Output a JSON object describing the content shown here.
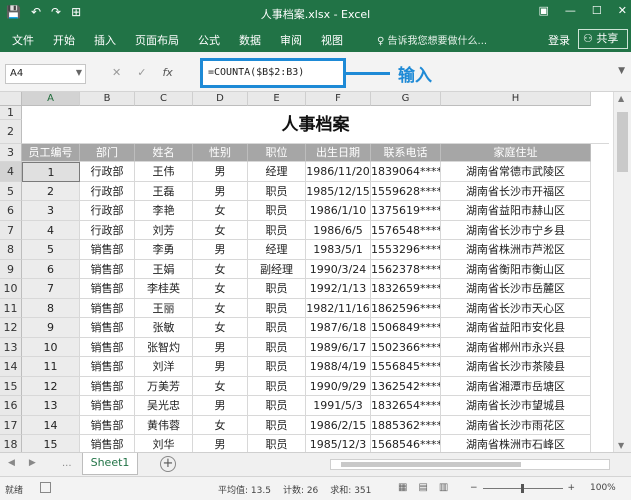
{
  "window": {
    "title": "人事档案.xlsx - Excel",
    "quick_access": [
      "💾",
      "↶",
      "↷",
      "⊞"
    ],
    "controls": [
      "▣",
      "—",
      "☐",
      "✕"
    ]
  },
  "ribbon": {
    "tabs": [
      "文件",
      "开始",
      "插入",
      "页面布局",
      "公式",
      "数据",
      "审阅",
      "视图"
    ],
    "tell_me": "告诉我您想要做什么...",
    "login": "登录",
    "share": "共享"
  },
  "formula_bar": {
    "name_box": "A4",
    "cancel": "✕",
    "enter": "✓",
    "fx": "fx",
    "formula": "=COUNTA($B$2:B3)",
    "callout": "输入"
  },
  "sheet": {
    "columns": [
      "A",
      "B",
      "C",
      "D",
      "E",
      "F",
      "G",
      "H"
    ],
    "title": "人事档案",
    "headers": [
      "员工编号",
      "部门",
      "姓名",
      "性别",
      "职位",
      "出生日期",
      "联系电话",
      "家庭住址"
    ],
    "rows": [
      [
        "1",
        "行政部",
        "王伟",
        "男",
        "经理",
        "1986/11/20",
        "1839064****",
        "湖南省常德市武陵区"
      ],
      [
        "2",
        "行政部",
        "王磊",
        "男",
        "职员",
        "1985/12/15",
        "1559628****",
        "湖南省长沙市开福区"
      ],
      [
        "3",
        "行政部",
        "李艳",
        "女",
        "职员",
        "1986/1/10",
        "1375619****",
        "湖南省益阳市赫山区"
      ],
      [
        "4",
        "行政部",
        "刘芳",
        "女",
        "职员",
        "1986/6/5",
        "1576548****",
        "湖南省长沙市宁乡县"
      ],
      [
        "5",
        "销售部",
        "李勇",
        "男",
        "经理",
        "1983/5/1",
        "1553296****",
        "湖南省株洲市芦淞区"
      ],
      [
        "6",
        "销售部",
        "王娟",
        "女",
        "副经理",
        "1990/3/24",
        "1562378****",
        "湖南省衡阳市衡山区"
      ],
      [
        "7",
        "销售部",
        "李桂英",
        "女",
        "职员",
        "1992/1/13",
        "1832659****",
        "湖南省长沙市岳麓区"
      ],
      [
        "8",
        "销售部",
        "王丽",
        "女",
        "职员",
        "1982/11/16",
        "1862596****",
        "湖南省长沙市天心区"
      ],
      [
        "9",
        "销售部",
        "张敏",
        "女",
        "职员",
        "1987/6/18",
        "1506849****",
        "湖南省益阳市安化县"
      ],
      [
        "10",
        "销售部",
        "张智灼",
        "男",
        "职员",
        "1989/6/17",
        "1502366****",
        "湖南省郴州市永兴县"
      ],
      [
        "11",
        "销售部",
        "刘洋",
        "男",
        "职员",
        "1988/4/19",
        "1556845****",
        "湖南省长沙市茶陵县"
      ],
      [
        "12",
        "销售部",
        "万美芳",
        "女",
        "职员",
        "1990/9/29",
        "1362542****",
        "湖南省湘潭市岳塘区"
      ],
      [
        "13",
        "销售部",
        "吴光忠",
        "男",
        "职员",
        "1991/5/3",
        "1832654****",
        "湖南省长沙市望城县"
      ],
      [
        "14",
        "销售部",
        "黄伟蓉",
        "女",
        "职员",
        "1986/2/15",
        "1885362****",
        "湖南省长沙市雨花区"
      ],
      [
        "15",
        "销售部",
        "刘华",
        "男",
        "职员",
        "1985/12/3",
        "1568546****",
        "湖南省株洲市石峰区"
      ]
    ]
  },
  "sheet_tabs": {
    "active": "Sheet1",
    "add": "+",
    "nav": [
      "◀",
      "▶"
    ],
    "ellipsis": "..."
  },
  "status_bar": {
    "ready": "就绪",
    "average": "平均值: 13.5",
    "count": "计数: 26",
    "sum": "求和: 351",
    "views": [
      "▦",
      "▤",
      "▥"
    ],
    "zoom_out": "−",
    "zoom_in": "+",
    "zoom": "100%"
  }
}
